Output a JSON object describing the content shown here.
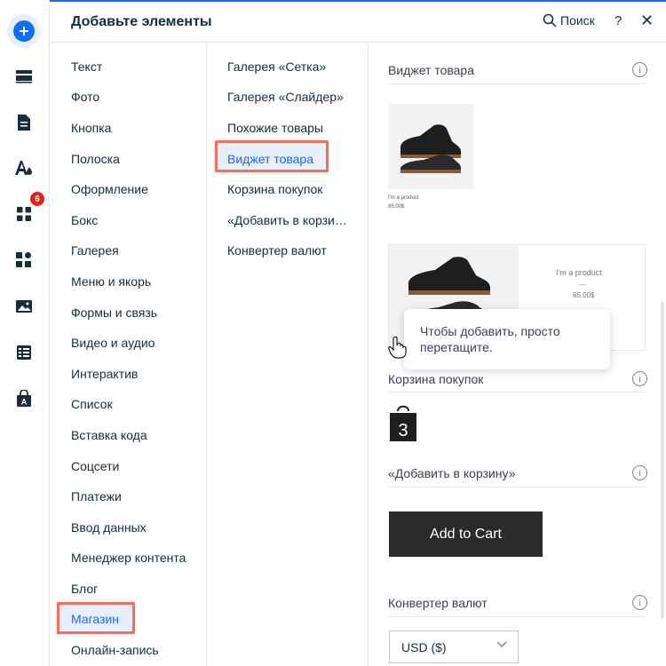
{
  "header": {
    "title": "Добавьте элементы",
    "search_label": "Поиск",
    "help_label": "?",
    "close_label": "✕"
  },
  "rail": {
    "badge_count": "6",
    "icons": [
      "add-icon",
      "sections-icon",
      "page-icon",
      "theme-icon",
      "apps-icon",
      "business-apps-icon",
      "media-icon",
      "cms-icon",
      "app-market-icon"
    ]
  },
  "categories": [
    "Текст",
    "Фото",
    "Кнопка",
    "Полоска",
    "Оформление",
    "Бокс",
    "Галерея",
    "Меню и якорь",
    "Формы и связь",
    "Видео и аудио",
    "Интерактив",
    "Список",
    "Вставка кода",
    "Соцсети",
    "Платежи",
    "Ввод данных",
    "Менеджер контента",
    "Блог",
    "Магазин",
    "Онлайн-запись"
  ],
  "selected_category": "Магазин",
  "subcategories": [
    "Галерея «Сетка»",
    "Галерея «Слайдер»",
    "Похожие товары",
    "Виджет товара",
    "Корзина покупок",
    "«Добавить в корзину»",
    "Конвертер валют"
  ],
  "selected_subcategory": "Виджет товара",
  "panel": {
    "section_product_widget": "Виджет товара",
    "section_cart": "Корзина покупок",
    "section_add_to_cart": "«Добавить в корзину»",
    "section_currency": "Конвертер валют",
    "info_label": "i",
    "thumb1_name": "I'm a product",
    "thumb1_price": "85.00$",
    "thumb2_name": "I'm a product",
    "thumb2_dash": "—",
    "thumb2_price": "85.00$",
    "tooltip": "Чтобы добавить, просто перетащите.",
    "cart_count": "3",
    "add_to_cart_label": "Add to Cart",
    "currency_value": "USD ($)"
  },
  "colors": {
    "accent": "#116dff",
    "highlight_border": "#f0705a",
    "badge": "#e62214"
  }
}
